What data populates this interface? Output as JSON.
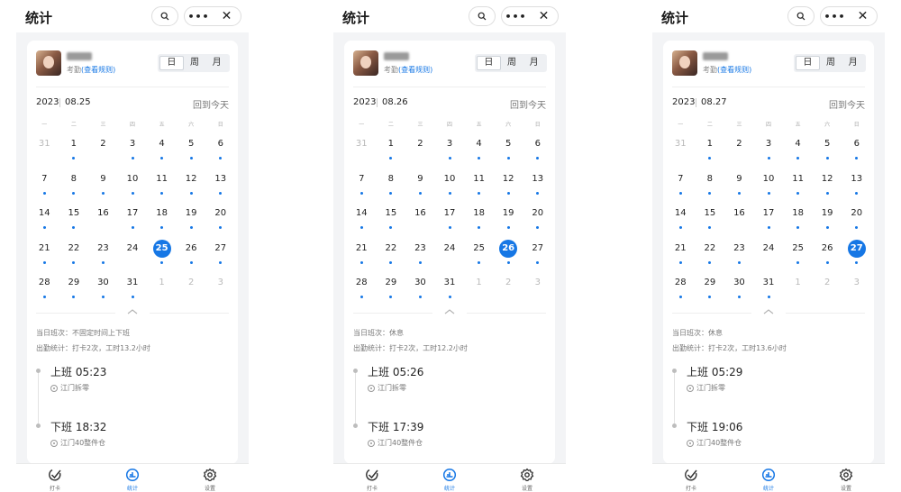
{
  "colors": {
    "accent": "#1677e5",
    "background": "#f3f4f6"
  },
  "panels": [
    {
      "title": "统计",
      "attendance_label": "考勤",
      "rules_link": "(查看规则)",
      "view_tabs": [
        "日",
        "周",
        "月"
      ],
      "active_tab": "日",
      "year": "2023",
      "month_day": "08.25",
      "back_today": "回到今天",
      "weekdays": [
        "一",
        "二",
        "三",
        "四",
        "五",
        "六",
        "日"
      ],
      "selected_day": "25",
      "shift_text": "当日班次：不固定时间上下班",
      "stats_text": "出勤统计：打卡2次，工时13.2小时",
      "punches": [
        {
          "label": "上班 05:23",
          "location": "江门拆零"
        },
        {
          "label": "下班 18:32",
          "location": "江门40整件仓"
        }
      ],
      "nav": [
        {
          "label": "打卡",
          "icon": "check-icon",
          "active": false
        },
        {
          "label": "统计",
          "icon": "stats-icon",
          "active": true
        },
        {
          "label": "设置",
          "icon": "gear-icon",
          "active": false
        }
      ]
    },
    {
      "title": "统计",
      "attendance_label": "考勤",
      "rules_link": "(查看规则)",
      "view_tabs": [
        "日",
        "周",
        "月"
      ],
      "active_tab": "日",
      "year": "2023",
      "month_day": "08.26",
      "back_today": "回到今天",
      "weekdays": [
        "一",
        "二",
        "三",
        "四",
        "五",
        "六",
        "日"
      ],
      "selected_day": "26",
      "shift_text": "当日班次：休息",
      "stats_text": "出勤统计：打卡2次，工时12.2小时",
      "punches": [
        {
          "label": "上班 05:26",
          "location": "江门拆零"
        },
        {
          "label": "下班 17:39",
          "location": "江门40整件仓"
        }
      ],
      "nav": [
        {
          "label": "打卡",
          "icon": "check-icon",
          "active": false
        },
        {
          "label": "统计",
          "icon": "stats-icon",
          "active": true
        },
        {
          "label": "设置",
          "icon": "gear-icon",
          "active": false
        }
      ]
    },
    {
      "title": "统计",
      "attendance_label": "考勤",
      "rules_link": "(查看规则)",
      "view_tabs": [
        "日",
        "周",
        "月"
      ],
      "active_tab": "日",
      "year": "2023",
      "month_day": "08.27",
      "back_today": "回到今天",
      "weekdays": [
        "一",
        "二",
        "三",
        "四",
        "五",
        "六",
        "日"
      ],
      "selected_day": "27",
      "shift_text": "当日班次：休息",
      "stats_text": "出勤统计：打卡2次，工时13.6小时",
      "punches": [
        {
          "label": "上班 05:29",
          "location": "江门拆零"
        },
        {
          "label": "下班 19:06",
          "location": "江门40整件仓"
        }
      ],
      "nav": [
        {
          "label": "打卡",
          "icon": "check-icon",
          "active": false
        },
        {
          "label": "统计",
          "icon": "stats-icon",
          "active": true
        },
        {
          "label": "设置",
          "icon": "gear-icon",
          "active": false
        }
      ]
    }
  ],
  "calendar_weeks": [
    [
      {
        "d": "31",
        "cur": false,
        "dot": false
      },
      {
        "d": "1",
        "cur": true,
        "dot": true
      },
      {
        "d": "2",
        "cur": true,
        "dot": false
      },
      {
        "d": "3",
        "cur": true,
        "dot": true
      },
      {
        "d": "4",
        "cur": true,
        "dot": true
      },
      {
        "d": "5",
        "cur": true,
        "dot": true
      },
      {
        "d": "6",
        "cur": true,
        "dot": true
      }
    ],
    [
      {
        "d": "7",
        "cur": true,
        "dot": true
      },
      {
        "d": "8",
        "cur": true,
        "dot": true
      },
      {
        "d": "9",
        "cur": true,
        "dot": true
      },
      {
        "d": "10",
        "cur": true,
        "dot": true
      },
      {
        "d": "11",
        "cur": true,
        "dot": true
      },
      {
        "d": "12",
        "cur": true,
        "dot": true
      },
      {
        "d": "13",
        "cur": true,
        "dot": true
      }
    ],
    [
      {
        "d": "14",
        "cur": true,
        "dot": true
      },
      {
        "d": "15",
        "cur": true,
        "dot": true
      },
      {
        "d": "16",
        "cur": true,
        "dot": false
      },
      {
        "d": "17",
        "cur": true,
        "dot": true
      },
      {
        "d": "18",
        "cur": true,
        "dot": true
      },
      {
        "d": "19",
        "cur": true,
        "dot": true
      },
      {
        "d": "20",
        "cur": true,
        "dot": true
      }
    ],
    [
      {
        "d": "21",
        "cur": true,
        "dot": true
      },
      {
        "d": "22",
        "cur": true,
        "dot": true
      },
      {
        "d": "23",
        "cur": true,
        "dot": true
      },
      {
        "d": "24",
        "cur": true,
        "dot": false
      },
      {
        "d": "25",
        "cur": true,
        "dot": true
      },
      {
        "d": "26",
        "cur": true,
        "dot": true
      },
      {
        "d": "27",
        "cur": true,
        "dot": true
      }
    ],
    [
      {
        "d": "28",
        "cur": true,
        "dot": true
      },
      {
        "d": "29",
        "cur": true,
        "dot": true
      },
      {
        "d": "30",
        "cur": true,
        "dot": true
      },
      {
        "d": "31",
        "cur": true,
        "dot": true
      },
      {
        "d": "1",
        "cur": false,
        "dot": false
      },
      {
        "d": "2",
        "cur": false,
        "dot": false
      },
      {
        "d": "3",
        "cur": false,
        "dot": false
      }
    ]
  ]
}
